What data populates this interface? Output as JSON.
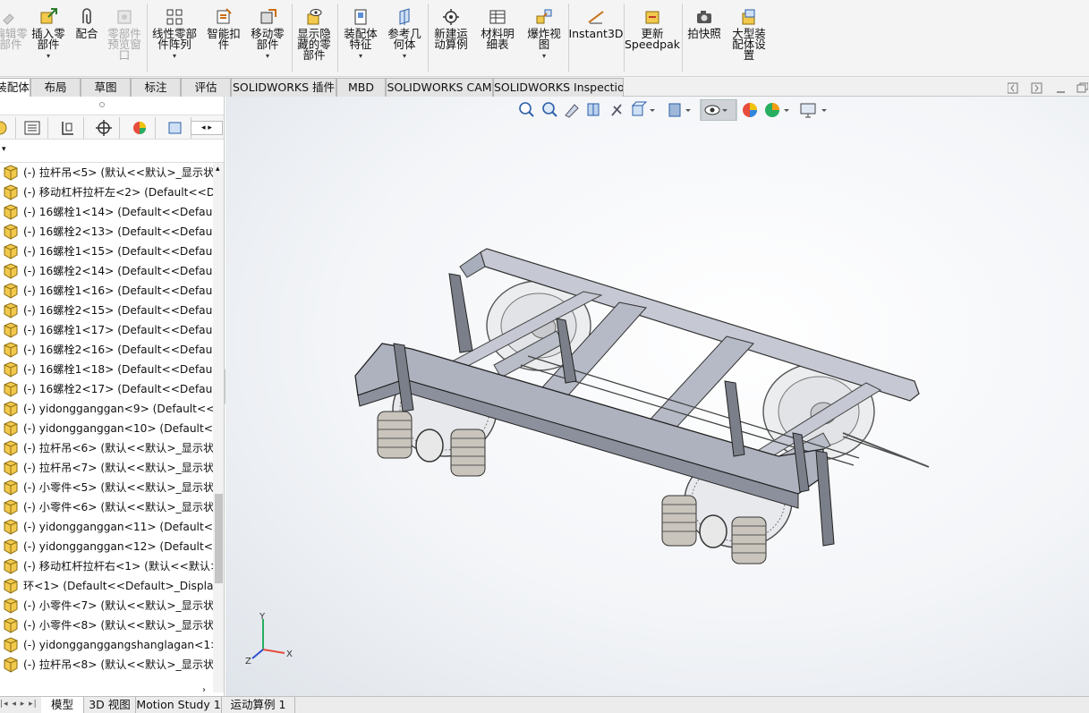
{
  "ribbon": {
    "items": [
      {
        "label": "编辑零\n部件",
        "disabled": true
      },
      {
        "label": "插入零\n部件",
        "disabled": false
      },
      {
        "label": "配合",
        "disabled": false
      },
      {
        "label": "零部件\n预览窗\n口",
        "disabled": true
      },
      {
        "label": "线性零部\n件阵列",
        "disabled": false
      },
      {
        "label": "智能扣\n件",
        "disabled": false
      },
      {
        "label": "移动零\n部件",
        "disabled": false
      },
      {
        "label": "显示隐\n藏的零\n部件",
        "disabled": false
      },
      {
        "label": "装配体\n特征",
        "disabled": false
      },
      {
        "label": "参考几\n何体",
        "disabled": false
      },
      {
        "label": "新建运\n动算例",
        "disabled": false
      },
      {
        "label": "材料明\n细表",
        "disabled": false
      },
      {
        "label": "爆炸视\n图",
        "disabled": false
      },
      {
        "label": "Instant3D",
        "disabled": false
      },
      {
        "label": "更新\nSpeedpak",
        "disabled": false
      },
      {
        "label": "拍快照",
        "disabled": false
      },
      {
        "label": "大型装\n配体设\n置",
        "disabled": false
      }
    ]
  },
  "tabs": [
    "装配体",
    "布局",
    "草图",
    "标注",
    "评估",
    "SOLIDWORKS 插件",
    "MBD",
    "SOLIDWORKS CAM",
    "SOLIDWORKS Inspection"
  ],
  "tree": [
    "(-) 拉杆吊<5> (默认<<默认>_显示状态",
    "(-) 移动杠杆拉杆左<2> (Default<<Def",
    "(-) 16螺栓1<14> (Default<<Default>_",
    "(-) 16螺栓2<13> (Default<<Default>_",
    "(-) 16螺栓1<15> (Default<<Default>_",
    "(-) 16螺栓2<14> (Default<<Default>_",
    "(-) 16螺栓1<16> (Default<<Default>_",
    "(-) 16螺栓2<15> (Default<<Default>_",
    "(-) 16螺栓1<17> (Default<<Default>_",
    "(-) 16螺栓2<16> (Default<<Default>_",
    "(-) 16螺栓1<18> (Default<<Default>_",
    "(-) 16螺栓2<17> (Default<<Default>_",
    "(-) yidongganggan<9> (Default<<D",
    "(-) yidongganggan<10> (Default<<I",
    "(-) 拉杆吊<6> (默认<<默认>_显示状态",
    "(-) 拉杆吊<7> (默认<<默认>_显示状态",
    "(-) 小零件<5> (默认<<默认>_显示状态",
    "(-) 小零件<6> (默认<<默认>_显示状态",
    "(-) yidongganggan<11> (Default<<I",
    "(-) yidongganggan<12> (Default<<I",
    "(-) 移动杠杆拉杆右<1> (默认<<默认>_",
    "环<1> (Default<<Default>_Display S",
    "(-) 小零件<7> (默认<<默认>_显示状态",
    "(-) 小零件<8> (默认<<默认>_显示状态",
    "(-) yidongganggangshanglagan<1> (",
    "(-) 拉杆吊<8> (默认<<默认>_显示状态"
  ],
  "triad": {
    "x": "X",
    "y": "Y",
    "z": "Z"
  },
  "bottom_tabs": [
    "模型",
    "3D 视图",
    "Motion Study 1",
    "运动算例 1"
  ],
  "colors": {
    "frame": "#a9aebd",
    "wheel": "#8f949c",
    "spring": "#b9a98a",
    "accent": "#e8b21f"
  }
}
